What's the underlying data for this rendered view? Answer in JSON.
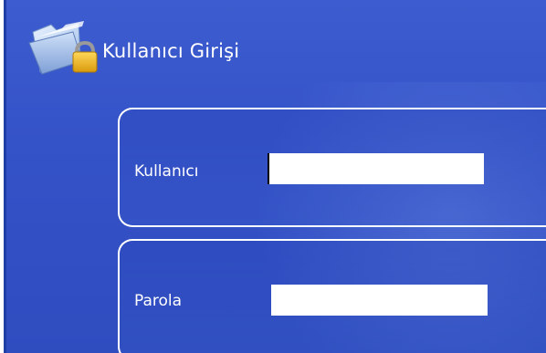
{
  "window": {
    "title": "Kullanıcı Girişi"
  },
  "icons": {
    "header_icon": "folder-lock-icon"
  },
  "form": {
    "username": {
      "label": "Kullanıcı",
      "value": ""
    },
    "password": {
      "label": "Parola",
      "value": ""
    }
  },
  "colors": {
    "background": "#3553c8",
    "text": "#ffffff",
    "input_background": "#ffffff",
    "lock": "#f2b81f"
  }
}
